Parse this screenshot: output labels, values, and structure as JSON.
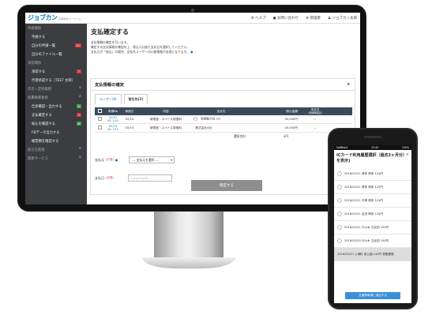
{
  "header": {
    "logo": "ジョブカン",
    "logo_sub": "経費精算/ワークフロー",
    "help": "ヘルプ",
    "contact": "お問い合わせ",
    "admin": "管理者",
    "user": "ジョブカン太郎"
  },
  "sidebar": {
    "items": [
      {
        "label": "申請関係",
        "type": "hd"
      },
      {
        "label": "申請する",
        "type": "sub"
      },
      {
        "label": "自分の申請一覧",
        "type": "sub",
        "badge": "12",
        "bc": "r"
      },
      {
        "label": "自分のファイル一覧",
        "type": "sub"
      },
      {
        "label": "承認関係",
        "type": "hd"
      },
      {
        "label": "承認する",
        "type": "sub",
        "badge": "7",
        "bc": "r"
      },
      {
        "label": "代理承認する（TEST 太郎）",
        "type": "sub"
      },
      {
        "label": "月次・定例業務",
        "type": "hd",
        "chev": "∨"
      },
      {
        "label": "経費精算業務",
        "type": "hd",
        "chev": "∧"
      },
      {
        "label": "仕訳確認・出力する",
        "type": "sub",
        "badge": "5",
        "bc": "g"
      },
      {
        "label": "支払確定する",
        "type": "sub",
        "badge": "2",
        "bc": "r"
      },
      {
        "label": "振込を確認する",
        "type": "sub",
        "badge": "6",
        "bc": "g"
      },
      {
        "label": "FBデータ出力する",
        "type": "sub"
      },
      {
        "label": "帳票類を確認する",
        "type": "sub"
      },
      {
        "label": "取引先管理",
        "type": "hd",
        "chev": "∨"
      },
      {
        "label": "関連サービス",
        "type": "hd",
        "chev": "∨"
      }
    ]
  },
  "main": {
    "title": "支払確定する",
    "desc": [
      "支払情報の確定を行います。",
      "確定する支払情報を確認の上、振込元口座と支払日を選択してください。",
      "支払元が「振込」の場合、支払先ユーザーの口座情報が必須になります。"
    ],
    "card_title": "支払情報の確定",
    "tabs": [
      "ユーザー(0)",
      "取引先(2)"
    ],
    "cols": [
      "申請No",
      "承認日",
      "内容",
      "支払先",
      "振込金額",
      "支払日"
    ],
    "col6_sub": "(申請時指定)",
    "rows": [
      {
        "no": "02/15",
        "id": "ID: 129",
        "date": "02/15",
        "content": "新規室・スペース賃借料",
        "payee": "新規取引先 (3)",
        "amt": "30,000円",
        "pay": "--"
      },
      {
        "no": "02/15",
        "id": "ID: 132",
        "date": "02/15",
        "content": "新規室・スペース賃借料",
        "payee": "株式会社A社",
        "amt": "40,000円",
        "pay": "--"
      }
    ],
    "total_label": "選択合計：",
    "total_val": "0円",
    "from_label": "支払元",
    "req": "(必須)",
    "from_sel": "--- 支払元を選択 ---",
    "date_label": "支払日",
    "date_ph": "yyyy/mm/dd",
    "submit": "確定する"
  },
  "phone": {
    "status_l": "SoftBank",
    "status_c": "12:45",
    "status_r": "100%",
    "title": "ICカード利用履歴選択（過去2ヶ月分）",
    "title2": "を表示)",
    "items": [
      "2018/02/21 博多 博多 124円",
      "2018/02/21 博多 博多 124円",
      "2018/02/21 天神 博多 124円",
      "2018/02/21 吉田 博多 124円",
      "2018/02/21 代々木 五反田 150円",
      "2018/02/20 代々木 五反田 150円",
      "2018/02/20 入場料 西公園 140円 物販履歴"
    ],
    "btn": "交通費申請に追加する"
  }
}
